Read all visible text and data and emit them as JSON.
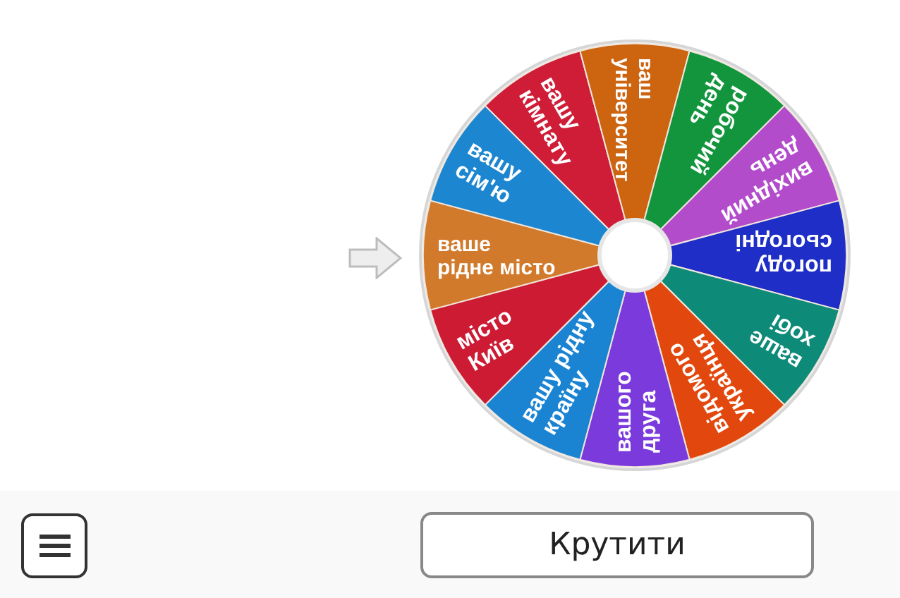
{
  "wheel": {
    "segments": [
      {
        "lines": [
          "ваше",
          "рідне місто"
        ],
        "color": "#d27a2c"
      },
      {
        "lines": [
          "вашу",
          "сім'ю"
        ],
        "color": "#1c86d0"
      },
      {
        "lines": [
          "вашу",
          "кімнату"
        ],
        "color": "#cf1d38"
      },
      {
        "lines": [
          "ваш",
          "університет"
        ],
        "color": "#cc6410"
      },
      {
        "lines": [
          "робочий",
          "день"
        ],
        "color": "#12953c"
      },
      {
        "lines": [
          "вихідний",
          "день"
        ],
        "color": "#b24ccb"
      },
      {
        "lines": [
          "погоду",
          "сьогодні"
        ],
        "color": "#1f2ec6"
      },
      {
        "lines": [
          "ваше",
          "хобі"
        ],
        "color": "#0d8a78"
      },
      {
        "lines": [
          "відомого",
          "українця"
        ],
        "color": "#e2480e"
      },
      {
        "lines": [
          "вашого",
          "друга"
        ],
        "color": "#7b3bdc"
      },
      {
        "lines": [
          "вашу рідну",
          "країну"
        ],
        "color": "#1a84d2"
      },
      {
        "lines": [
          "місто",
          "Київ"
        ],
        "color": "#cc1b33"
      }
    ]
  },
  "spin_button": {
    "label": "Крутити"
  }
}
